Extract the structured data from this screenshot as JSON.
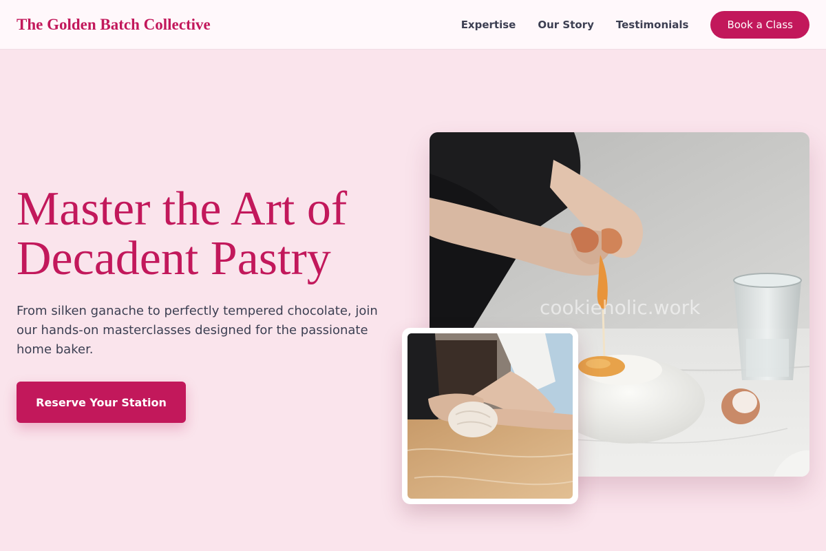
{
  "header": {
    "logo": "The Golden Batch Collective",
    "nav": [
      "Expertise",
      "Our Story",
      "Testimonials"
    ],
    "cta_label": "Book a Class"
  },
  "hero": {
    "title_line1": "Master the Art of",
    "title_line2": "Decadent Pastry",
    "subtitle": "From silken ganache to perfectly tempered chocolate, join our hands-on masterclasses designed for the passionate home baker.",
    "cta_label": "Reserve Your Station",
    "watermark": "cookieholic.work"
  },
  "colors": {
    "accent": "#c2185b",
    "page_background": "#fae4ec",
    "header_background": "#fff8fb",
    "body_text": "#3c3f52"
  }
}
